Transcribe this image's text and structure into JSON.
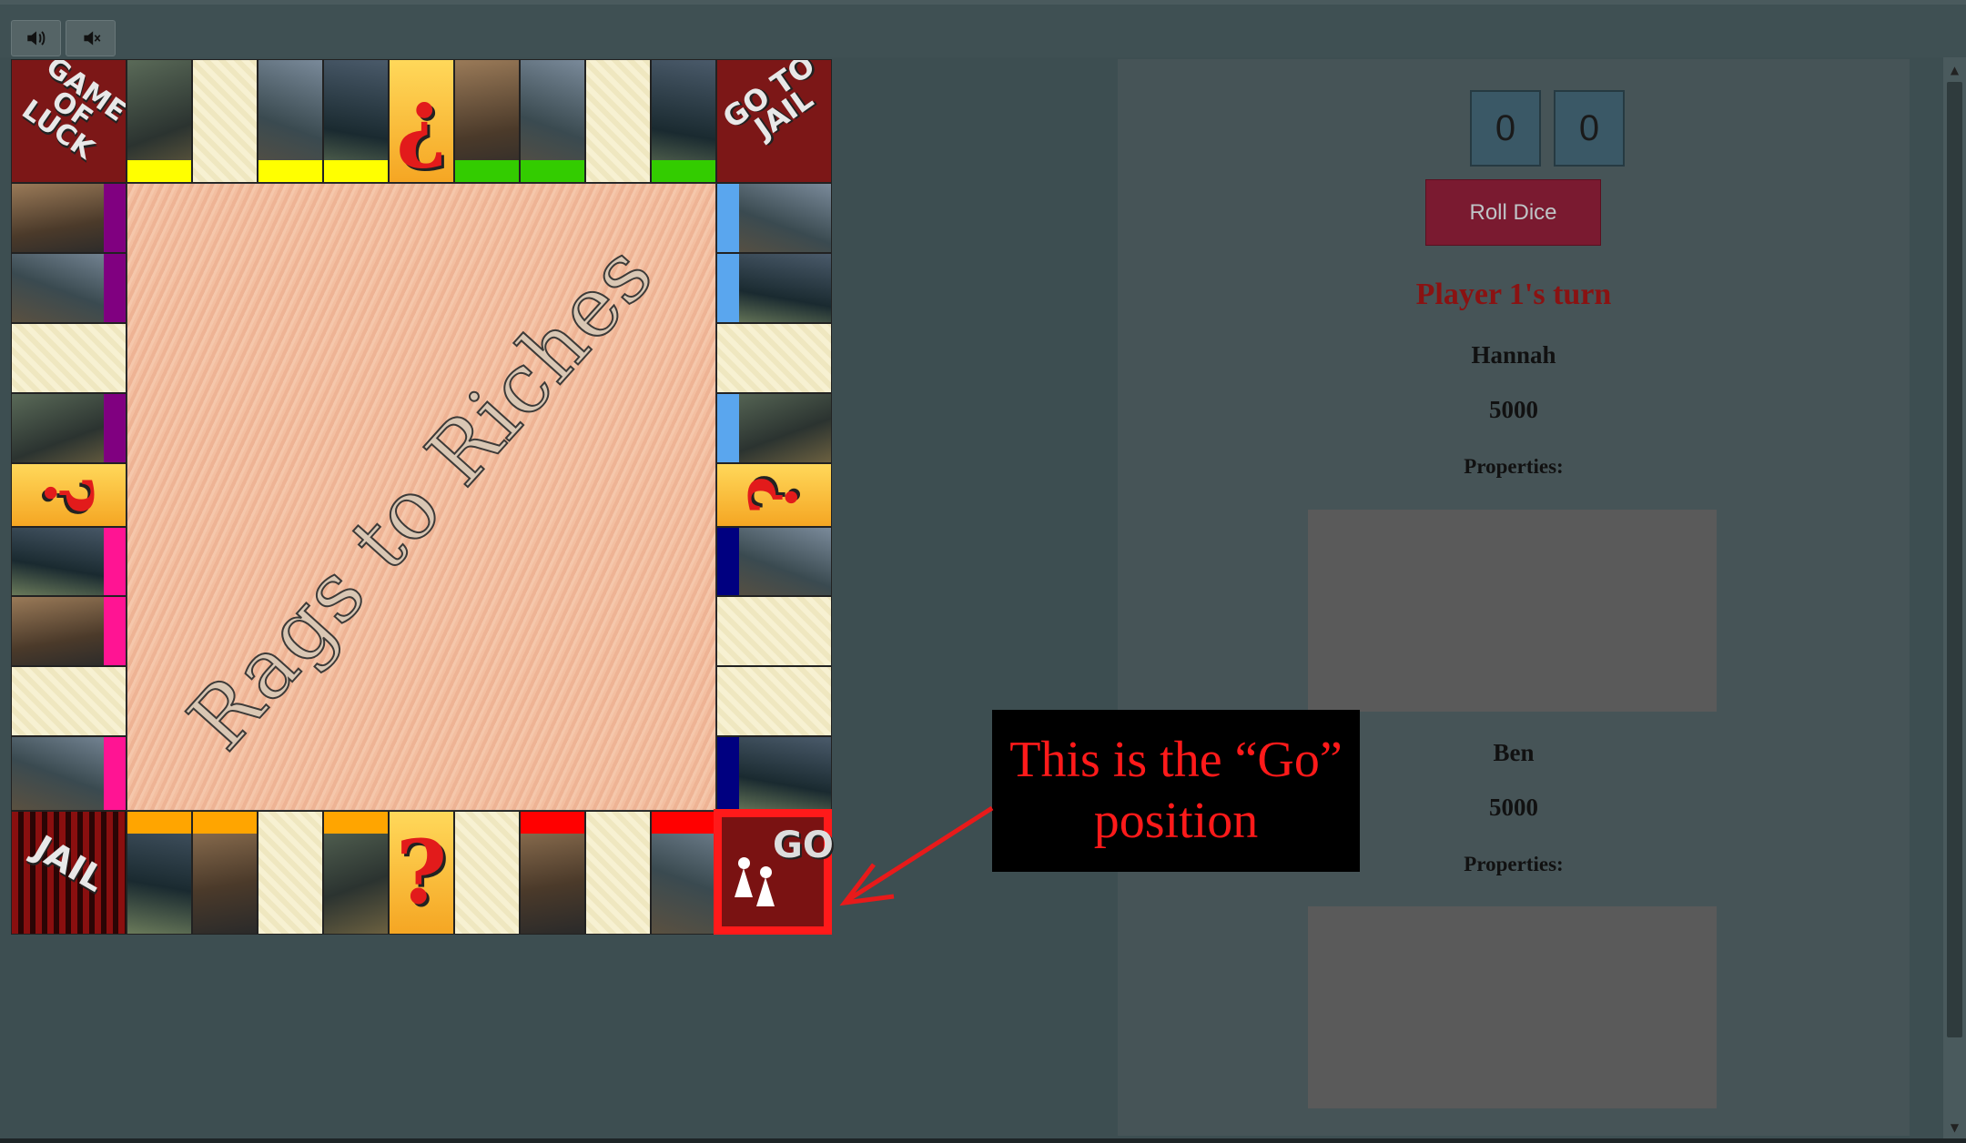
{
  "toolbar": {
    "sound_on_icon": "speaker-on-icon",
    "sound_off_icon": "speaker-muted-icon"
  },
  "board": {
    "title": "Rags to Riches",
    "corners": {
      "top_left": "GAME OF LUCK",
      "top_right": "GO TO JAIL",
      "bottom_left": "JAIL",
      "bottom_right": "GO"
    },
    "chance_symbol_top": "¿",
    "chance_symbol": "?",
    "colors": {
      "yellow": "#ffff00",
      "green": "#33cc00",
      "purple": "#800080",
      "pink": "#ff1493",
      "light_blue": "#5aa6ee",
      "dark_blue": "#000080",
      "orange": "#ffa500",
      "red": "#ff0000"
    }
  },
  "dice": {
    "die1": "0",
    "die2": "0",
    "roll_label": "Roll Dice"
  },
  "turn": {
    "label": "Player 1's turn"
  },
  "players": [
    {
      "name": "Hannah",
      "money": "5000",
      "properties_label": "Properties:"
    },
    {
      "name": "Ben",
      "money": "5000",
      "properties_label": "Properties:"
    }
  ],
  "annotation": {
    "text": "This is the “Go” position",
    "color": "#ff1a1a"
  }
}
